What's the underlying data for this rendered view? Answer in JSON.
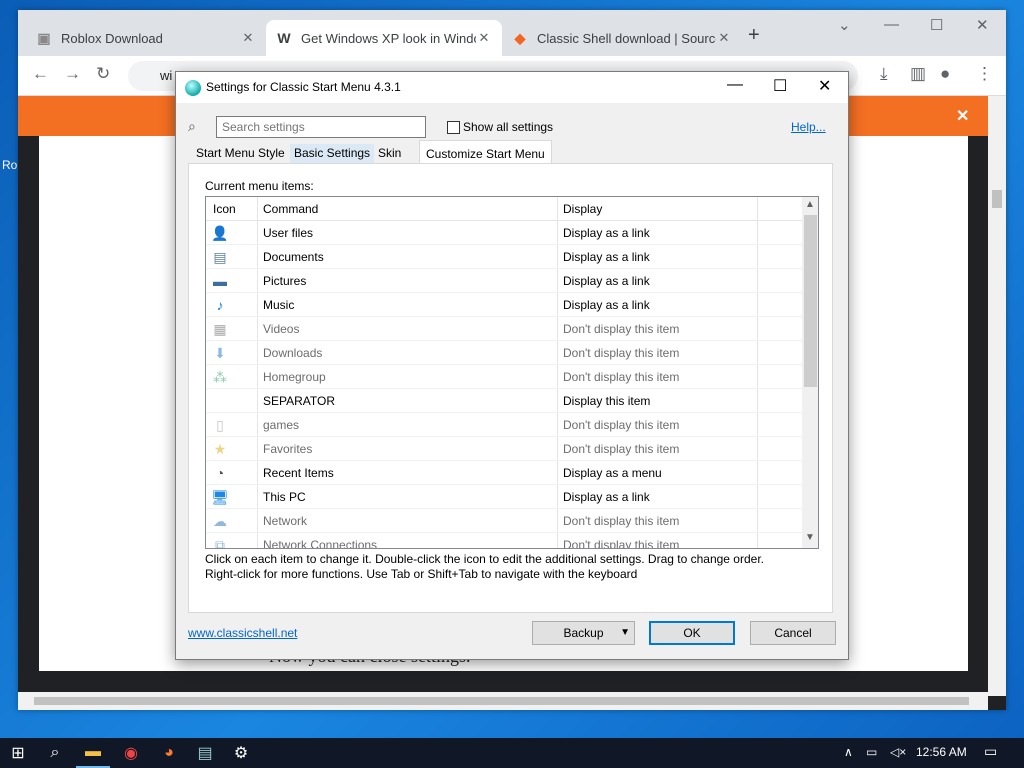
{
  "desktop": {
    "label": "Ro"
  },
  "browser": {
    "tabs": [
      {
        "title": "Roblox Download",
        "favicon": "R"
      },
      {
        "title": "Get Windows XP look in Windo",
        "favicon": "W"
      },
      {
        "title": "Classic Shell download | Source",
        "favicon": "◆"
      }
    ],
    "address": "wi",
    "page_text": "Now you can close settings."
  },
  "dialog": {
    "title": "Settings for Classic Start Menu 4.3.1",
    "search_placeholder": "Search settings",
    "show_all_label": "Show all settings",
    "help_label": "Help...",
    "tabs": [
      "Start Menu Style",
      "Basic Settings",
      "Skin",
      "Customize Start Menu"
    ],
    "current_items_label": "Current menu items:",
    "columns": {
      "icon": "Icon",
      "command": "Command",
      "display": "Display"
    },
    "rows": [
      {
        "command": "User files",
        "display": "Display as a link",
        "icon": "user-icon",
        "dim": false
      },
      {
        "command": "Documents",
        "display": "Display as a link",
        "icon": "documents-icon",
        "dim": false
      },
      {
        "command": "Pictures",
        "display": "Display as a link",
        "icon": "pictures-icon",
        "dim": false
      },
      {
        "command": "Music",
        "display": "Display as a link",
        "icon": "music-icon",
        "dim": false
      },
      {
        "command": "Videos",
        "display": "Don't display this item",
        "icon": "videos-icon",
        "dim": true
      },
      {
        "command": "Downloads",
        "display": "Don't display this item",
        "icon": "downloads-icon",
        "dim": true
      },
      {
        "command": "Homegroup",
        "display": "Don't display this item",
        "icon": "homegroup-icon",
        "dim": true
      },
      {
        "command": "SEPARATOR",
        "display": "Display this item",
        "icon": "",
        "dim": false
      },
      {
        "command": "games",
        "display": "Don't display this item",
        "icon": "games-icon",
        "dim": true
      },
      {
        "command": "Favorites",
        "display": "Don't display this item",
        "icon": "favorites-icon",
        "dim": true
      },
      {
        "command": "Recent Items",
        "display": "Display as a menu",
        "icon": "recent-items-icon",
        "dim": false
      },
      {
        "command": "This PC",
        "display": "Display as a link",
        "icon": "this-pc-icon",
        "dim": false
      },
      {
        "command": "Network",
        "display": "Don't display this item",
        "icon": "network-icon",
        "dim": true
      },
      {
        "command": "Network Connections",
        "display": "Don't display this item",
        "icon": "network-connections-icon",
        "dim": true
      }
    ],
    "hint_line1": "Click on each item to change it. Double-click the icon to edit the additional settings. Drag to change order.",
    "hint_line2": "Right-click for more functions. Use Tab or Shift+Tab to navigate with the keyboard",
    "site_link": "www.classicshell.net",
    "backup_label": "Backup",
    "ok_label": "OK",
    "cancel_label": "Cancel"
  },
  "taskbar": {
    "time": "12:56 AM"
  }
}
